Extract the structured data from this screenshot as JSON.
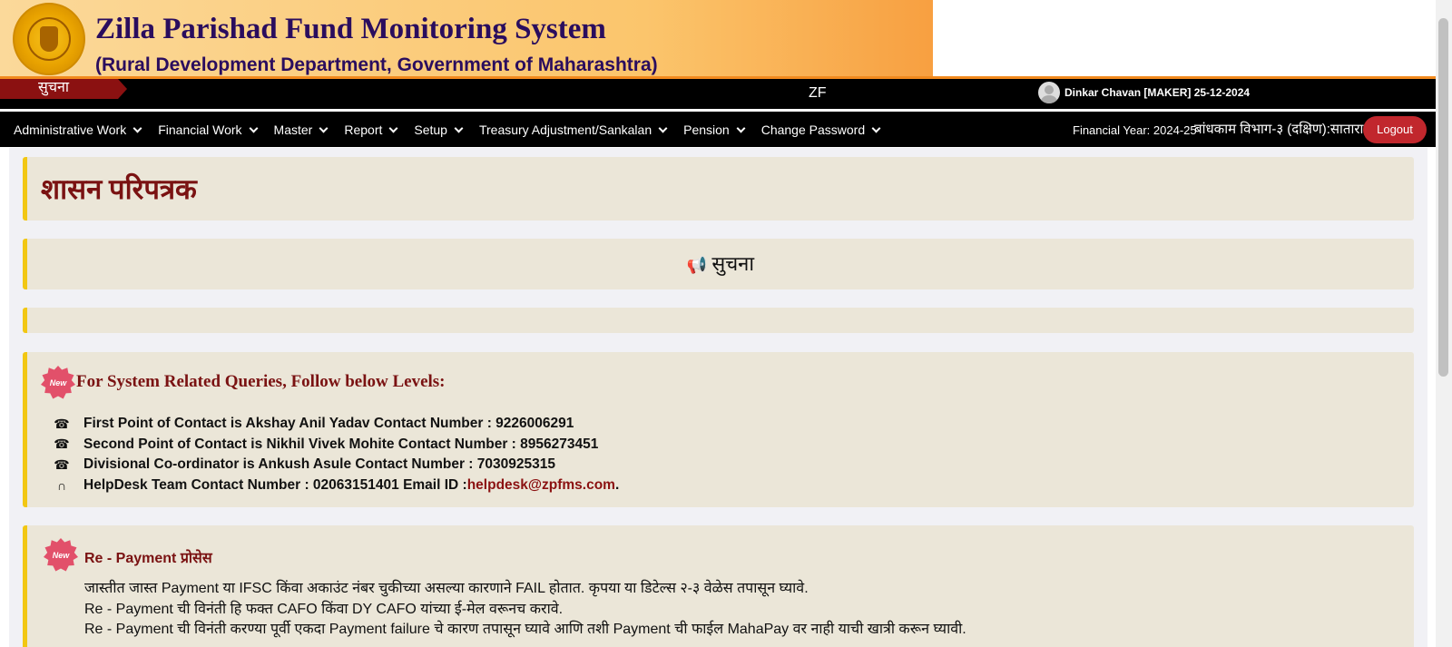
{
  "header": {
    "title": "Zilla Parishad Fund Monitoring System",
    "subtitle": "(Rural Development Department, Government of Maharashtra)",
    "logo": "maharashtra-emblem"
  },
  "notice_bar": {
    "tag": "सुचना",
    "marquee": "ZF",
    "user": "Dinkar Chavan [MAKER] 25-12-2024"
  },
  "nav": {
    "items": [
      {
        "label": "Administrative Work"
      },
      {
        "label": "Financial Work"
      },
      {
        "label": "Master"
      },
      {
        "label": "Report"
      },
      {
        "label": "Setup"
      },
      {
        "label": "Treasury Adjustment/Sankalan"
      },
      {
        "label": "Pension"
      },
      {
        "label": "Change Password"
      }
    ],
    "financial_year": "Financial Year: 2024-25",
    "department": "बांधकाम विभाग-३ (दक्षिण):सातारा",
    "logout": "Logout"
  },
  "panels": {
    "circular_title": "शासन परिपत्रक",
    "notice_title": "सुचना",
    "queries": {
      "badge": "New",
      "title": "For System Related Queries, Follow below Levels:",
      "contacts": [
        {
          "icon": "phone-icon",
          "text": "First Point of Contact is Akshay Anil Yadav  Contact Number : 9226006291"
        },
        {
          "icon": "phone-icon",
          "text": "Second Point of Contact is Nikhil Vivek Mohite  Contact Number : 8956273451"
        },
        {
          "icon": "phone-icon",
          "text": "Divisional Co-ordinator is Ankush Asule  Contact Number : 7030925315"
        },
        {
          "icon": "headset-icon",
          "text": "HelpDesk  Team Contact Number : 02063151401  Email ID : "
        }
      ],
      "email": "helpdesk@zpfms.com",
      "email_suffix": "."
    },
    "repayment": {
      "badge": "New",
      "title": "Re - Payment प्रोसेस",
      "lines": [
        "जास्तीत जास्त Payment या IFSC किंवा अकाउंट नंबर चुकीच्या असल्या कारणाने FAIL होतात. कृपया या डिटेल्स २-३ वेळेस तपासून घ्यावे.",
        "Re - Payment ची विनंती हि फक्त CAFO किंवा DY CAFO यांच्या ई-मेल वरूनच करावे.",
        "Re - Payment ची विनंती करण्या पूर्वी एकदा Payment failure चे कारण तपासून घ्यावे आणि तशी Payment ची फाईल MahaPay वर नाही याची खात्री करून घ्यावी."
      ]
    }
  }
}
